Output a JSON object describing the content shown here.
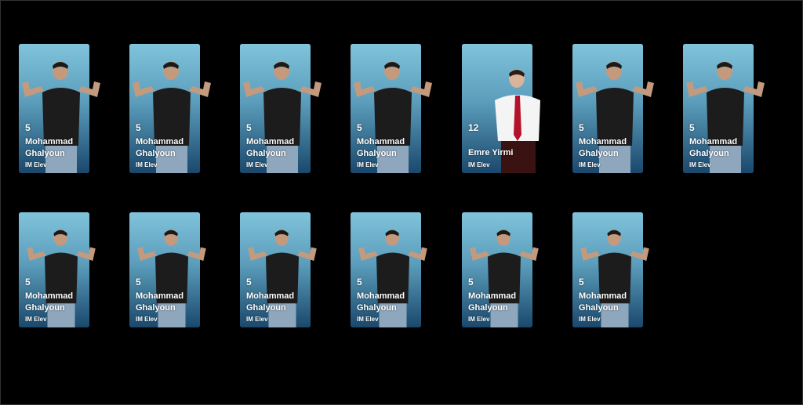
{
  "cards": [
    {
      "number": "5",
      "name": "Mohammad Ghalyoun",
      "role": "IM Elev",
      "figure": "flexing-man"
    },
    {
      "number": "5",
      "name": "Mohammad Ghalyoun",
      "role": "IM Elev",
      "figure": "flexing-man"
    },
    {
      "number": "5",
      "name": "Mohammad Ghalyoun",
      "role": "IM Elev",
      "figure": "flexing-man"
    },
    {
      "number": "5",
      "name": "Mohammad Ghalyoun",
      "role": "IM Elev",
      "figure": "flexing-man"
    },
    {
      "number": "12",
      "name": "Emre Yirmi",
      "role": "IM Elev",
      "figure": "man-white-shirt-red-tie"
    },
    {
      "number": "5",
      "name": "Mohammad Ghalyoun",
      "role": "IM Elev",
      "figure": "flexing-man"
    },
    {
      "number": "5",
      "name": "Mohammad Ghalyoun",
      "role": "IM Elev",
      "figure": "flexing-man"
    },
    {
      "number": "5",
      "name": "Mohammad Ghalyoun",
      "role": "IM Elev",
      "figure": "flexing-man"
    },
    {
      "number": "5",
      "name": "Mohammad Ghalyoun",
      "role": "IM Elev",
      "figure": "flexing-man"
    },
    {
      "number": "5",
      "name": "Mohammad Ghalyoun",
      "role": "IM Elev",
      "figure": "flexing-man"
    },
    {
      "number": "5",
      "name": "Mohammad Ghalyoun",
      "role": "IM Elev",
      "figure": "flexing-man"
    },
    {
      "number": "5",
      "name": "Mohammad Ghalyoun",
      "role": "IM Elev",
      "figure": "flexing-man"
    },
    {
      "number": "5",
      "name": "Mohammad Ghalyoun",
      "role": "IM Elev",
      "figure": "flexing-man"
    }
  ],
  "colors": {
    "background": "#000000",
    "card_top": "#80c3db",
    "card_bottom": "#1a486c",
    "shirt_dark": "#1c1c1c",
    "tie": "#b3122a"
  }
}
